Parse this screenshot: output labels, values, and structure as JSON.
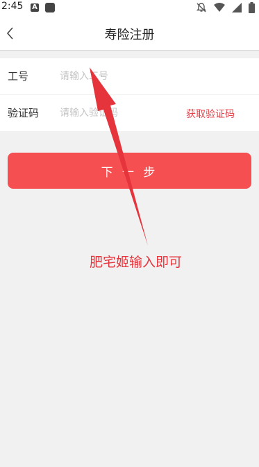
{
  "status_bar": {
    "time": "2:45",
    "notification_icon_letter": "A"
  },
  "nav": {
    "title": "寿险注册"
  },
  "form": {
    "employee_id": {
      "label": "工号",
      "placeholder": "请输入工号",
      "value": ""
    },
    "verification": {
      "label": "验证码",
      "placeholder": "请输入验证码",
      "value": "",
      "get_code_label": "获取验证码"
    }
  },
  "next_button_label": "下 一 步",
  "annotation": {
    "text": "肥宅姬输入即可",
    "color": "#e5343b"
  },
  "colors": {
    "accent": "#f54f52",
    "link": "#e5434b",
    "background": "#f1f1f1"
  }
}
